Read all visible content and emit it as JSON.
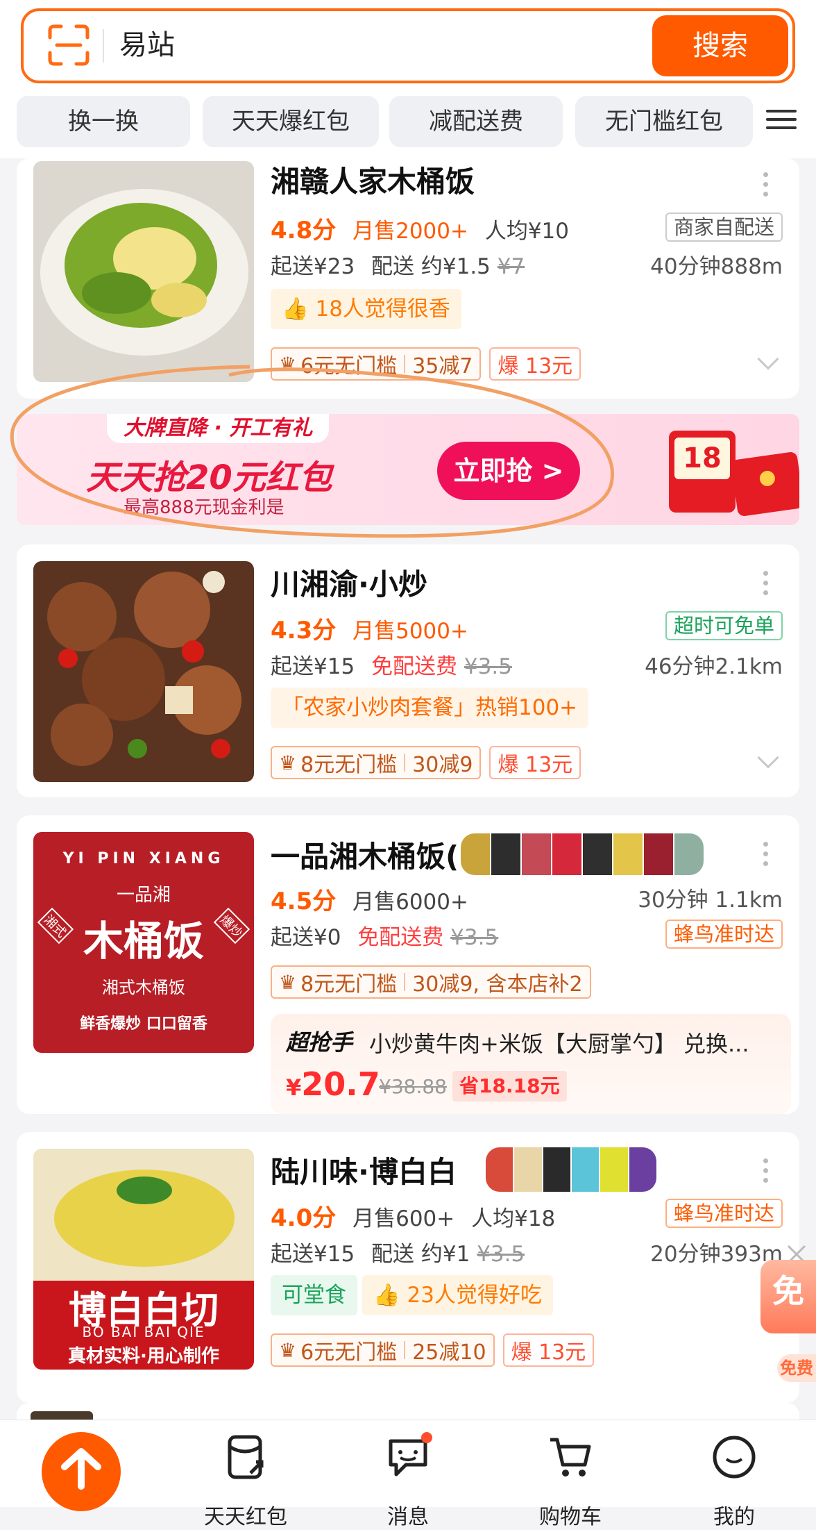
{
  "search": {
    "value": "易站",
    "button": "搜索"
  },
  "chips": [
    "换一换",
    "天天爆红包",
    "减配送费",
    "无门槛红包"
  ],
  "banner": {
    "tag": "大牌直降 · 开工有礼",
    "title": "天天抢20元红包",
    "subtitle": "最高888元现金利是",
    "button": "立即抢 >",
    "badge": "18"
  },
  "stores": [
    {
      "name": "湘赣人家木桶饭",
      "score": "4.8分",
      "sales": "月售2000+",
      "avg": "人均¥10",
      "tag": "商家自配送",
      "min_order": "起送¥23",
      "delivery": "配送 约¥1.5",
      "delivery_old": "¥7",
      "time_dist": "40分钟888m",
      "highlight": "18人觉得很香",
      "promo": [
        "6元无门槛",
        "35减7"
      ],
      "bao": "爆 13元"
    },
    {
      "name": "川湘渝·小炒",
      "score": "4.3分",
      "sales": "月售5000+",
      "tag": "超时可免单",
      "min_order": "起送¥15",
      "delivery": "免配送费",
      "delivery_old": "¥3.5",
      "time_dist": "46分钟2.1km",
      "highlight": "「农家小炒肉套餐」热销100+",
      "promo": [
        "8元无门槛",
        "30减9"
      ],
      "bao": "爆 13元"
    },
    {
      "name": "一品湘木桶饭(",
      "score": "4.5分",
      "sales": "月售6000+",
      "time_dist": "30分钟 1.1km",
      "min_order": "起送¥0",
      "delivery": "免配送费",
      "delivery_old": "¥3.5",
      "tag": "蜂鸟准时达",
      "promo": [
        "8元无门槛",
        "30减9, 含本店补2"
      ],
      "deal": {
        "logo": "超抢手",
        "text": "小炒黄牛肉+米饭【大厨掌勺】 兑换...",
        "price_symbol": "¥",
        "price": "20.7",
        "old_price": "¥38.88",
        "save": "省18.18元"
      },
      "image": {
        "top": "YI PIN XIANG",
        "brand": "一品湘",
        "main": "木桶饭",
        "left": "湘式",
        "right": "爆炒",
        "sub": "湘式木桶饭",
        "slogan": "鲜香爆炒  口口留香"
      }
    },
    {
      "name": "陆川味·博白白",
      "score": "4.0分",
      "sales": "月售600+",
      "avg": "人均¥18",
      "tag": "蜂鸟准时达",
      "min_order": "起送¥15",
      "delivery": "配送 约¥1",
      "delivery_old": "¥3.5",
      "time_dist": "20分钟393m",
      "pill_green": "可堂食",
      "highlight": "23人觉得好吃",
      "promo": [
        "6元无门槛",
        "25减10"
      ],
      "bao": "爆 13元",
      "image": {
        "main": "博白白切",
        "pinyin": "BO BAI BAI QIE",
        "slogan": "真材实料·用心制作"
      }
    }
  ],
  "float": {
    "main": "免",
    "mini": "免费"
  },
  "tabbar": [
    "天天红包",
    "消息",
    "购物车",
    "我的"
  ]
}
